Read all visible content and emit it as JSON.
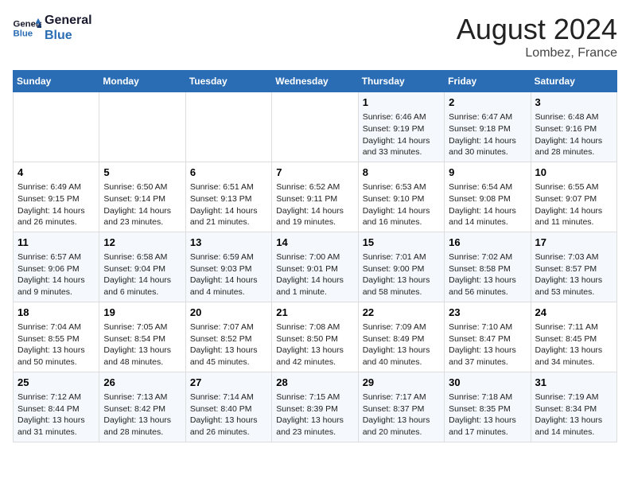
{
  "header": {
    "logo_line1": "General",
    "logo_line2": "Blue",
    "month_year": "August 2024",
    "location": "Lombez, France"
  },
  "weekdays": [
    "Sunday",
    "Monday",
    "Tuesday",
    "Wednesday",
    "Thursday",
    "Friday",
    "Saturday"
  ],
  "weeks": [
    [
      {
        "day": "",
        "info": ""
      },
      {
        "day": "",
        "info": ""
      },
      {
        "day": "",
        "info": ""
      },
      {
        "day": "",
        "info": ""
      },
      {
        "day": "1",
        "info": "Sunrise: 6:46 AM\nSunset: 9:19 PM\nDaylight: 14 hours\nand 33 minutes."
      },
      {
        "day": "2",
        "info": "Sunrise: 6:47 AM\nSunset: 9:18 PM\nDaylight: 14 hours\nand 30 minutes."
      },
      {
        "day": "3",
        "info": "Sunrise: 6:48 AM\nSunset: 9:16 PM\nDaylight: 14 hours\nand 28 minutes."
      }
    ],
    [
      {
        "day": "4",
        "info": "Sunrise: 6:49 AM\nSunset: 9:15 PM\nDaylight: 14 hours\nand 26 minutes."
      },
      {
        "day": "5",
        "info": "Sunrise: 6:50 AM\nSunset: 9:14 PM\nDaylight: 14 hours\nand 23 minutes."
      },
      {
        "day": "6",
        "info": "Sunrise: 6:51 AM\nSunset: 9:13 PM\nDaylight: 14 hours\nand 21 minutes."
      },
      {
        "day": "7",
        "info": "Sunrise: 6:52 AM\nSunset: 9:11 PM\nDaylight: 14 hours\nand 19 minutes."
      },
      {
        "day": "8",
        "info": "Sunrise: 6:53 AM\nSunset: 9:10 PM\nDaylight: 14 hours\nand 16 minutes."
      },
      {
        "day": "9",
        "info": "Sunrise: 6:54 AM\nSunset: 9:08 PM\nDaylight: 14 hours\nand 14 minutes."
      },
      {
        "day": "10",
        "info": "Sunrise: 6:55 AM\nSunset: 9:07 PM\nDaylight: 14 hours\nand 11 minutes."
      }
    ],
    [
      {
        "day": "11",
        "info": "Sunrise: 6:57 AM\nSunset: 9:06 PM\nDaylight: 14 hours\nand 9 minutes."
      },
      {
        "day": "12",
        "info": "Sunrise: 6:58 AM\nSunset: 9:04 PM\nDaylight: 14 hours\nand 6 minutes."
      },
      {
        "day": "13",
        "info": "Sunrise: 6:59 AM\nSunset: 9:03 PM\nDaylight: 14 hours\nand 4 minutes."
      },
      {
        "day": "14",
        "info": "Sunrise: 7:00 AM\nSunset: 9:01 PM\nDaylight: 14 hours\nand 1 minute."
      },
      {
        "day": "15",
        "info": "Sunrise: 7:01 AM\nSunset: 9:00 PM\nDaylight: 13 hours\nand 58 minutes."
      },
      {
        "day": "16",
        "info": "Sunrise: 7:02 AM\nSunset: 8:58 PM\nDaylight: 13 hours\nand 56 minutes."
      },
      {
        "day": "17",
        "info": "Sunrise: 7:03 AM\nSunset: 8:57 PM\nDaylight: 13 hours\nand 53 minutes."
      }
    ],
    [
      {
        "day": "18",
        "info": "Sunrise: 7:04 AM\nSunset: 8:55 PM\nDaylight: 13 hours\nand 50 minutes."
      },
      {
        "day": "19",
        "info": "Sunrise: 7:05 AM\nSunset: 8:54 PM\nDaylight: 13 hours\nand 48 minutes."
      },
      {
        "day": "20",
        "info": "Sunrise: 7:07 AM\nSunset: 8:52 PM\nDaylight: 13 hours\nand 45 minutes."
      },
      {
        "day": "21",
        "info": "Sunrise: 7:08 AM\nSunset: 8:50 PM\nDaylight: 13 hours\nand 42 minutes."
      },
      {
        "day": "22",
        "info": "Sunrise: 7:09 AM\nSunset: 8:49 PM\nDaylight: 13 hours\nand 40 minutes."
      },
      {
        "day": "23",
        "info": "Sunrise: 7:10 AM\nSunset: 8:47 PM\nDaylight: 13 hours\nand 37 minutes."
      },
      {
        "day": "24",
        "info": "Sunrise: 7:11 AM\nSunset: 8:45 PM\nDaylight: 13 hours\nand 34 minutes."
      }
    ],
    [
      {
        "day": "25",
        "info": "Sunrise: 7:12 AM\nSunset: 8:44 PM\nDaylight: 13 hours\nand 31 minutes."
      },
      {
        "day": "26",
        "info": "Sunrise: 7:13 AM\nSunset: 8:42 PM\nDaylight: 13 hours\nand 28 minutes."
      },
      {
        "day": "27",
        "info": "Sunrise: 7:14 AM\nSunset: 8:40 PM\nDaylight: 13 hours\nand 26 minutes."
      },
      {
        "day": "28",
        "info": "Sunrise: 7:15 AM\nSunset: 8:39 PM\nDaylight: 13 hours\nand 23 minutes."
      },
      {
        "day": "29",
        "info": "Sunrise: 7:17 AM\nSunset: 8:37 PM\nDaylight: 13 hours\nand 20 minutes."
      },
      {
        "day": "30",
        "info": "Sunrise: 7:18 AM\nSunset: 8:35 PM\nDaylight: 13 hours\nand 17 minutes."
      },
      {
        "day": "31",
        "info": "Sunrise: 7:19 AM\nSunset: 8:34 PM\nDaylight: 13 hours\nand 14 minutes."
      }
    ]
  ]
}
